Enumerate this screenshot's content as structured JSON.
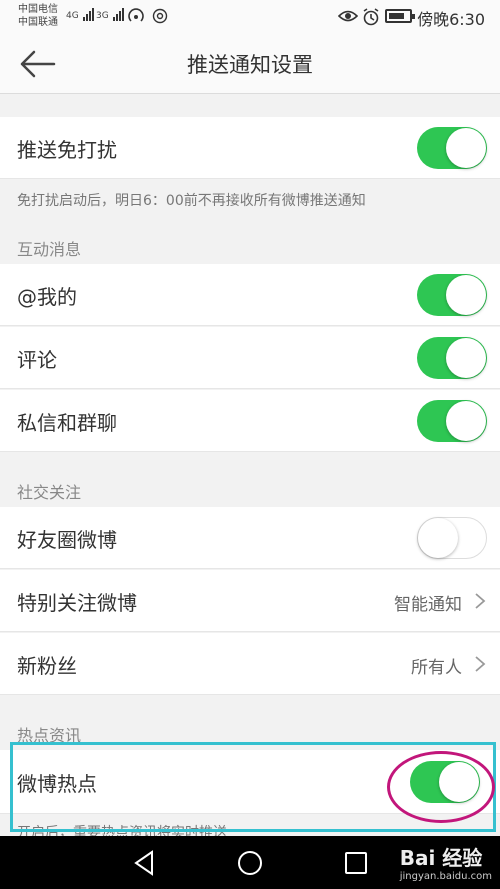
{
  "status_bar": {
    "carrier1": "中国电信",
    "carrier2": "中国联通",
    "sig1_label": "4G",
    "sig2_label": "3G",
    "time": "傍晚6:30",
    "battery_level": 0.8
  },
  "header": {
    "title": "推送通知设置"
  },
  "dnd": {
    "label": "推送免打扰",
    "on": true,
    "note": "免打扰启动后，明日6：00前不再接收所有微博推送通知"
  },
  "interaction": {
    "title": "互动消息",
    "items": [
      {
        "label": "@我的",
        "on": true
      },
      {
        "label": "评论",
        "on": true
      },
      {
        "label": "私信和群聊",
        "on": true
      }
    ]
  },
  "social": {
    "title": "社交关注",
    "friends": {
      "label": "好友圈微博",
      "on": false
    },
    "special": {
      "label": "特别关注微博",
      "value": "智能通知"
    },
    "fans": {
      "label": "新粉丝",
      "value": "所有人"
    }
  },
  "hot": {
    "title": "热点资讯",
    "item": {
      "label": "微博热点",
      "on": true
    },
    "note": "开启后，重要热点资讯将实时推送"
  },
  "watermark": {
    "brand": "Bai 经验",
    "url": "jingyan.baidu.com"
  },
  "colors": {
    "toggle_on": "#2ec653",
    "highlight_box": "#35c0cf",
    "highlight_circle": "#c2167b"
  }
}
